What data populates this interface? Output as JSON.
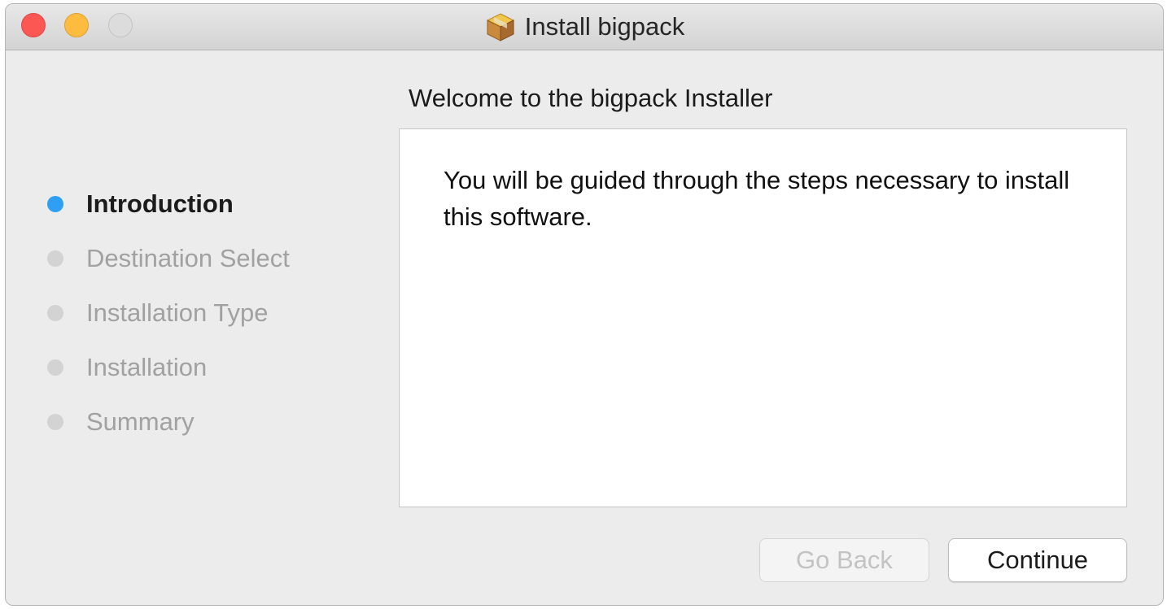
{
  "window": {
    "title": "Install bigpack",
    "title_icon": "package-icon"
  },
  "steps": [
    {
      "label": "Introduction",
      "state": "active"
    },
    {
      "label": "Destination Select",
      "state": "pending"
    },
    {
      "label": "Installation Type",
      "state": "pending"
    },
    {
      "label": "Installation",
      "state": "pending"
    },
    {
      "label": "Summary",
      "state": "pending"
    }
  ],
  "main": {
    "heading": "Welcome to the bigpack Installer",
    "body": "You will be guided through the steps necessary to install this software."
  },
  "buttons": {
    "back_label": "Go Back",
    "back_enabled": false,
    "continue_label": "Continue"
  },
  "colors": {
    "active_step": "#2f9ff5",
    "close": "#fc5753",
    "minimize": "#fdbc40",
    "zoom_disabled": "#dcdcdc"
  }
}
